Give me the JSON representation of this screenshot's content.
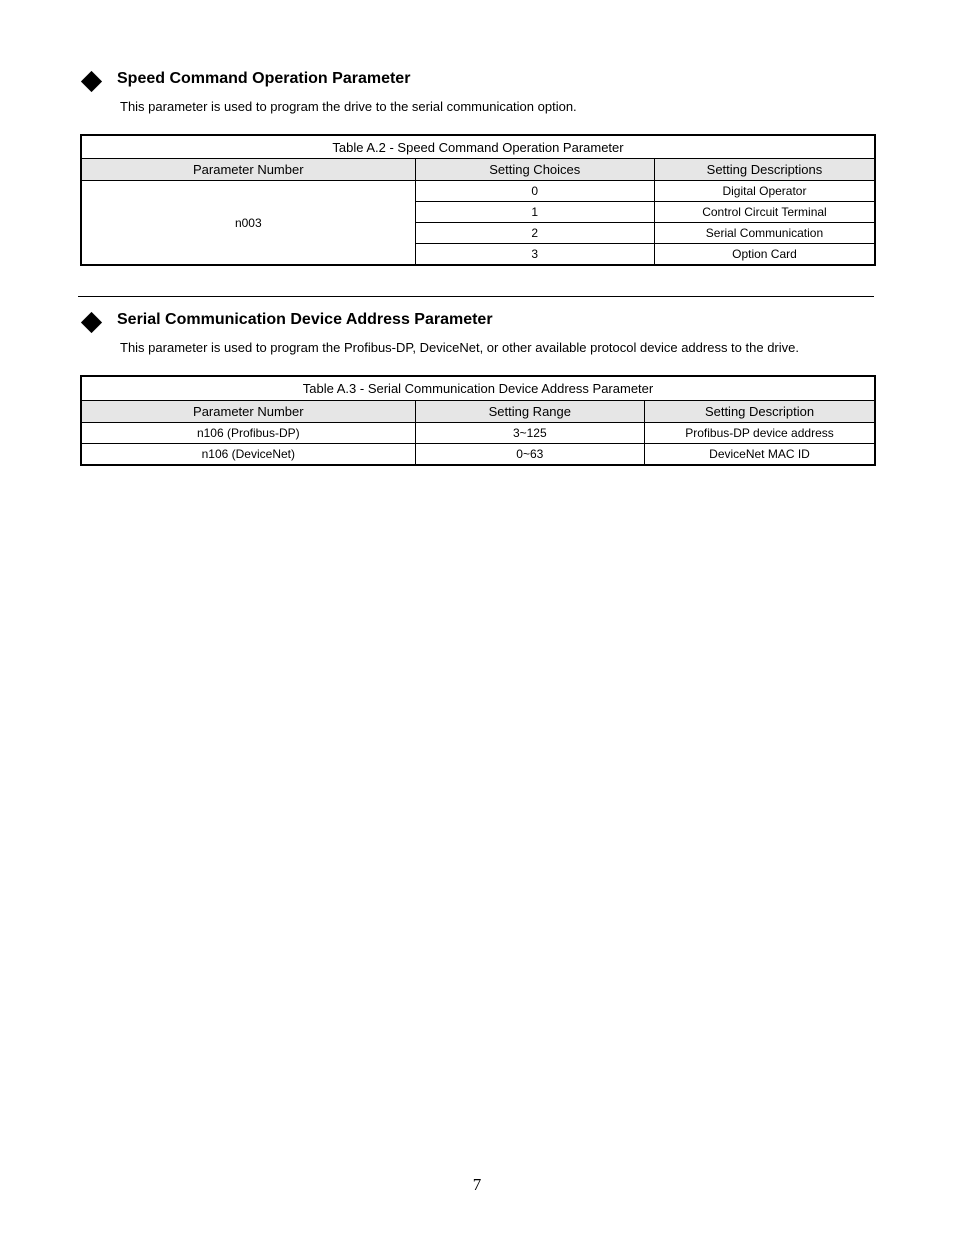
{
  "sectionA": {
    "title": "Speed Command Operation Parameter",
    "desc": "This parameter is used to program the drive to the serial communication option.",
    "table": {
      "caption": "Table A.2 - Speed Command Operation Parameter",
      "headers": [
        "Parameter Number",
        "Setting Choices",
        "Setting Descriptions"
      ],
      "paramNo": "n003",
      "rows": [
        {
          "choice": "0",
          "desc": "Digital Operator"
        },
        {
          "choice": "1",
          "desc": "Control Circuit Terminal"
        },
        {
          "choice": "2",
          "desc": "Serial Communication"
        },
        {
          "choice": "3",
          "desc": "Option Card"
        }
      ]
    }
  },
  "sectionB": {
    "title": "Serial Communication Device Address Parameter",
    "desc": "This parameter is used to program the Profibus-DP, DeviceNet, or other available protocol device address to the drive.",
    "table": {
      "caption": "Table A.3 - Serial Communication Device Address Parameter",
      "headers": [
        "Parameter Number",
        "Setting Range",
        "Setting Description"
      ],
      "rows": [
        {
          "param": "n106 (Profibus-DP)",
          "range": "3~125",
          "desc": "Profibus-DP device address"
        },
        {
          "param": "n106 (DeviceNet)",
          "range": "0~63",
          "desc": "DeviceNet MAC ID"
        }
      ]
    }
  },
  "pageNumber": "7"
}
